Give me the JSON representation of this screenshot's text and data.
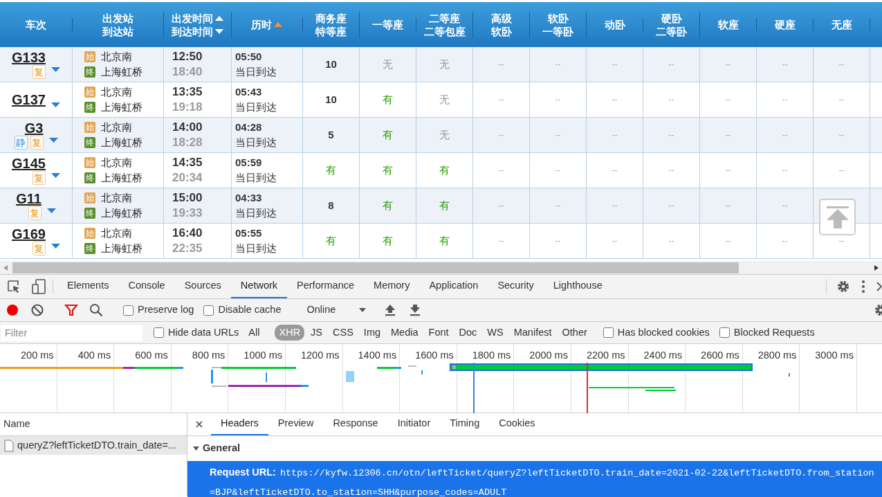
{
  "table": {
    "columns": [
      {
        "lines": [
          "车次"
        ]
      },
      {
        "lines": [
          "出发站",
          "到达站"
        ]
      },
      {
        "lines": [
          "出发时间",
          "到达时间"
        ],
        "sort_up_icon": true,
        "sort_down_icon": true
      },
      {
        "lines": [
          "历时"
        ],
        "sort_up_icon": true,
        "sort_active": true
      },
      {
        "lines": [
          "商务座",
          "特等座"
        ]
      },
      {
        "lines": [
          "一等座"
        ]
      },
      {
        "lines": [
          "二等座",
          "二等包座"
        ]
      },
      {
        "lines": [
          "高级",
          "软卧"
        ]
      },
      {
        "lines": [
          "软卧",
          "一等卧"
        ]
      },
      {
        "lines": [
          "动卧"
        ]
      },
      {
        "lines": [
          "硬卧",
          "二等卧"
        ]
      },
      {
        "lines": [
          "软座"
        ]
      },
      {
        "lines": [
          "硬座"
        ]
      },
      {
        "lines": [
          "无座"
        ]
      }
    ],
    "rows": [
      {
        "train": "G133",
        "badges": [
          {
            "text": "复",
            "kind": "fu"
          }
        ],
        "from": {
          "badge": "始",
          "name": "北京南"
        },
        "to": {
          "badge": "终",
          "name": "上海虹桥"
        },
        "depart": "12:50",
        "arrive": "18:40",
        "duration": "05:50",
        "arrival_day": "当日到达",
        "seats": [
          {
            "text": "10",
            "kind": "count"
          },
          {
            "text": "无",
            "kind": "no"
          },
          {
            "text": "无",
            "kind": "no"
          },
          {
            "text": "--",
            "kind": "na"
          },
          {
            "text": "--",
            "kind": "na"
          },
          {
            "text": "--",
            "kind": "na"
          },
          {
            "text": "--",
            "kind": "na"
          },
          {
            "text": "--",
            "kind": "na"
          },
          {
            "text": "--",
            "kind": "na"
          },
          {
            "text": "--",
            "kind": "na"
          }
        ]
      },
      {
        "train": "G137",
        "badges": [],
        "from": {
          "badge": "始",
          "name": "北京南"
        },
        "to": {
          "badge": "终",
          "name": "上海虹桥"
        },
        "depart": "13:35",
        "arrive": "19:18",
        "duration": "05:43",
        "arrival_day": "当日到达",
        "seats": [
          {
            "text": "10",
            "kind": "count"
          },
          {
            "text": "有",
            "kind": "yes"
          },
          {
            "text": "无",
            "kind": "no"
          },
          {
            "text": "--",
            "kind": "na"
          },
          {
            "text": "--",
            "kind": "na"
          },
          {
            "text": "--",
            "kind": "na"
          },
          {
            "text": "--",
            "kind": "na"
          },
          {
            "text": "--",
            "kind": "na"
          },
          {
            "text": "--",
            "kind": "na"
          },
          {
            "text": "--",
            "kind": "na"
          }
        ]
      },
      {
        "train": "G3",
        "badges": [
          {
            "text": "静",
            "kind": "jing"
          },
          {
            "text": "复",
            "kind": "fu"
          }
        ],
        "from": {
          "badge": "始",
          "name": "北京南"
        },
        "to": {
          "badge": "终",
          "name": "上海虹桥"
        },
        "depart": "14:00",
        "arrive": "18:28",
        "duration": "04:28",
        "arrival_day": "当日到达",
        "seats": [
          {
            "text": "5",
            "kind": "count"
          },
          {
            "text": "有",
            "kind": "yes"
          },
          {
            "text": "无",
            "kind": "no"
          },
          {
            "text": "--",
            "kind": "na"
          },
          {
            "text": "--",
            "kind": "na"
          },
          {
            "text": "--",
            "kind": "na"
          },
          {
            "text": "--",
            "kind": "na"
          },
          {
            "text": "--",
            "kind": "na"
          },
          {
            "text": "--",
            "kind": "na"
          },
          {
            "text": "--",
            "kind": "na"
          }
        ]
      },
      {
        "train": "G145",
        "badges": [
          {
            "text": "复",
            "kind": "fu"
          }
        ],
        "from": {
          "badge": "始",
          "name": "北京南"
        },
        "to": {
          "badge": "终",
          "name": "上海虹桥"
        },
        "depart": "14:35",
        "arrive": "20:34",
        "duration": "05:59",
        "arrival_day": "当日到达",
        "seats": [
          {
            "text": "有",
            "kind": "yes"
          },
          {
            "text": "有",
            "kind": "yes"
          },
          {
            "text": "有",
            "kind": "yes"
          },
          {
            "text": "--",
            "kind": "na"
          },
          {
            "text": "--",
            "kind": "na"
          },
          {
            "text": "--",
            "kind": "na"
          },
          {
            "text": "--",
            "kind": "na"
          },
          {
            "text": "--",
            "kind": "na"
          },
          {
            "text": "--",
            "kind": "na"
          },
          {
            "text": "--",
            "kind": "na"
          }
        ]
      },
      {
        "train": "G11",
        "badges": [
          {
            "text": "复",
            "kind": "fu"
          }
        ],
        "from": {
          "badge": "始",
          "name": "北京南"
        },
        "to": {
          "badge": "终",
          "name": "上海虹桥"
        },
        "depart": "15:00",
        "arrive": "19:33",
        "duration": "04:33",
        "arrival_day": "当日到达",
        "seats": [
          {
            "text": "8",
            "kind": "count"
          },
          {
            "text": "有",
            "kind": "yes"
          },
          {
            "text": "有",
            "kind": "yes"
          },
          {
            "text": "--",
            "kind": "na"
          },
          {
            "text": "--",
            "kind": "na"
          },
          {
            "text": "--",
            "kind": "na"
          },
          {
            "text": "--",
            "kind": "na"
          },
          {
            "text": "--",
            "kind": "na"
          },
          {
            "text": "--",
            "kind": "na"
          }
        ]
      },
      {
        "train": "G169",
        "badges": [
          {
            "text": "复",
            "kind": "fu"
          }
        ],
        "from": {
          "badge": "始",
          "name": "北京南"
        },
        "to": {
          "badge": "终",
          "name": "上海虹桥"
        },
        "depart": "16:40",
        "arrive": "22:35",
        "duration": "05:55",
        "arrival_day": "当日到达",
        "seats": [
          {
            "text": "有",
            "kind": "yes"
          },
          {
            "text": "有",
            "kind": "yes"
          },
          {
            "text": "有",
            "kind": "yes"
          },
          {
            "text": "--",
            "kind": "na"
          },
          {
            "text": "--",
            "kind": "na"
          },
          {
            "text": "--",
            "kind": "na"
          },
          {
            "text": "--",
            "kind": "na"
          },
          {
            "text": "--",
            "kind": "na"
          },
          {
            "text": "--",
            "kind": "na"
          },
          {
            "text": "--",
            "kind": "na"
          }
        ]
      }
    ]
  },
  "devtools": {
    "tabs": [
      {
        "label": "Elements",
        "selected": false
      },
      {
        "label": "Console",
        "selected": false
      },
      {
        "label": "Sources",
        "selected": false
      },
      {
        "label": "Network",
        "selected": true
      },
      {
        "label": "Performance",
        "selected": false
      },
      {
        "label": "Memory",
        "selected": false
      },
      {
        "label": "Application",
        "selected": false
      },
      {
        "label": "Security",
        "selected": false
      },
      {
        "label": "Lighthouse",
        "selected": false
      }
    ],
    "toolbar": {
      "recording": true,
      "filter_active": true,
      "preserve_log": {
        "label": "Preserve log",
        "checked": false
      },
      "disable_cache": {
        "label": "Disable cache",
        "checked": false
      },
      "throttling": "Online"
    },
    "filter": {
      "placeholder": "Filter",
      "hide_data_urls": {
        "label": "Hide data URLs",
        "checked": false
      },
      "types": [
        {
          "label": "All",
          "selected": false
        },
        {
          "label": "XHR",
          "selected": true
        },
        {
          "label": "JS",
          "selected": false
        },
        {
          "label": "CSS",
          "selected": false
        },
        {
          "label": "Img",
          "selected": false
        },
        {
          "label": "Media",
          "selected": false
        },
        {
          "label": "Font",
          "selected": false
        },
        {
          "label": "Doc",
          "selected": false
        },
        {
          "label": "WS",
          "selected": false
        },
        {
          "label": "Manifest",
          "selected": false
        },
        {
          "label": "Other",
          "selected": false
        }
      ],
      "blocked_cookies": {
        "label": "Has blocked cookies",
        "checked": false
      },
      "blocked_requests": {
        "label": "Blocked Requests",
        "checked": false
      }
    },
    "timeline_ticks": [
      "200 ms",
      "400 ms",
      "600 ms",
      "800 ms",
      "1000 ms",
      "1200 ms",
      "1400 ms",
      "1600 ms",
      "1800 ms",
      "2000 ms",
      "2200 ms",
      "2400 ms",
      "2600 ms",
      "2800 ms",
      "3000 ms"
    ],
    "requests": {
      "header": "Name",
      "items": [
        {
          "name": "queryZ?leftTicketDTO.train_date=...",
          "selected": true
        }
      ]
    },
    "detail_tabs": [
      {
        "label": "Headers",
        "selected": true
      },
      {
        "label": "Preview",
        "selected": false
      },
      {
        "label": "Response",
        "selected": false
      },
      {
        "label": "Initiator",
        "selected": false
      },
      {
        "label": "Timing",
        "selected": false
      },
      {
        "label": "Cookies",
        "selected": false
      }
    ],
    "general": {
      "title": "General",
      "expanded": true,
      "rows": [
        {
          "label": "Request URL:",
          "value": "https://kyfw.12306.cn/otn/leftTicket/queryZ?leftTicketDTO.train_date=2021-02-22&leftTicketDTO.from_station=BJP&leftTicketDTO.to_station=SHH&purpose_codes=ADULT",
          "selected": true
        }
      ]
    }
  }
}
